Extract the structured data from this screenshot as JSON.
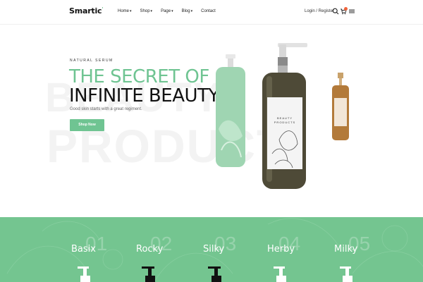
{
  "brand": {
    "logo_text": "Smartic",
    "logo_mark": "'"
  },
  "nav": [
    {
      "label": "Home",
      "has_dropdown": true
    },
    {
      "label": "Shop",
      "has_dropdown": true
    },
    {
      "label": "Page",
      "has_dropdown": true
    },
    {
      "label": "Blog",
      "has_dropdown": true
    },
    {
      "label": "Contact",
      "has_dropdown": false
    }
  ],
  "header": {
    "login_label": "Login / Register",
    "icons": [
      "search-icon",
      "cart-icon",
      "menu-icon"
    ]
  },
  "hero": {
    "kicker": "NATURAL SERUM",
    "title_line1": "THE SECRET OF",
    "title_line2": "INFINITE BEAUTY",
    "subtitle": "Good skin starts with a great regiment.",
    "cta_label": "Shop Now",
    "bg_word_1": "BEAUTY",
    "bg_word_2": "PRODUCT",
    "bottle_label": "BEAUTY PRODUCTS"
  },
  "categories": [
    {
      "name": "Basix",
      "number": "01"
    },
    {
      "name": "Rocky",
      "number": "02"
    },
    {
      "name": "Silky",
      "number": "03"
    },
    {
      "name": "Herby",
      "number": "04"
    },
    {
      "name": "Milky",
      "number": "05"
    }
  ],
  "colors": {
    "accent": "#6fc492",
    "band": "#74c590",
    "badge": "#f0633b"
  }
}
